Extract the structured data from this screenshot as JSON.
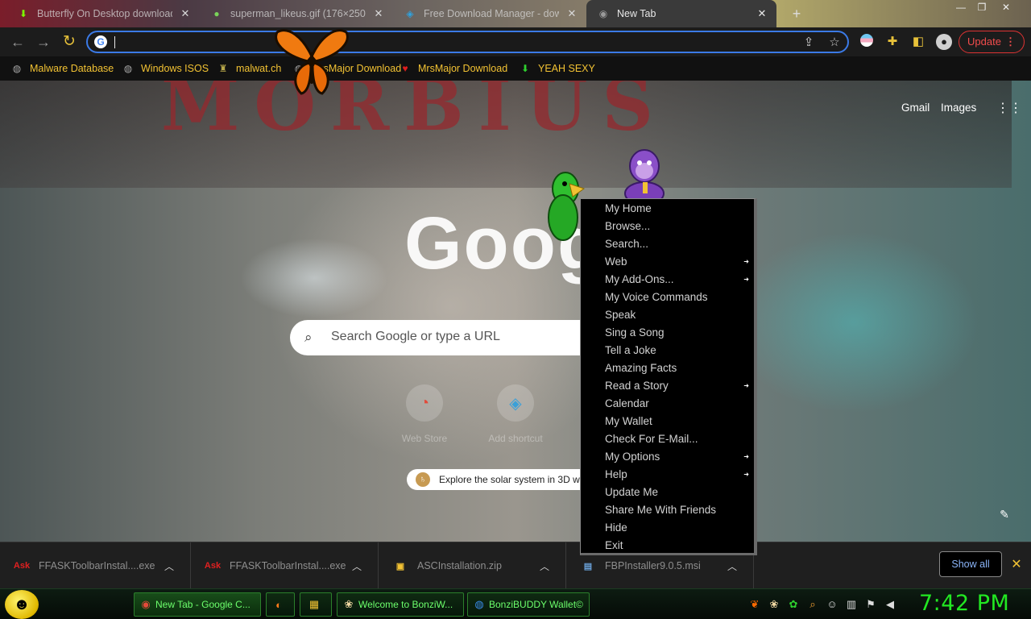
{
  "tabs": [
    {
      "title": "Butterfly On Desktop download -",
      "favicon": "download-arrow-icon",
      "close": "✕"
    },
    {
      "title": "superman_likeus.gif (176×250)",
      "favicon": "android-leaf-icon",
      "close": "✕"
    },
    {
      "title": "Free Download Manager - dow",
      "favicon": "fdm-icon",
      "close": "✕"
    },
    {
      "title": "New Tab",
      "favicon": "chrome-grey-icon",
      "close": "✕"
    }
  ],
  "toolbar": {
    "omnibox_value": "",
    "update_label": "Update",
    "update_dots": "⋮"
  },
  "bookmarks": [
    {
      "label": "Malware Database",
      "icon": "globe-icon"
    },
    {
      "label": "Windows ISOS",
      "icon": "globe-icon"
    },
    {
      "label": "malwat.ch",
      "icon": "android-icon"
    },
    {
      "label": "MrsMajor Download",
      "icon": "globe-icon"
    },
    {
      "label": "MrsMajor Download",
      "icon": "heart-icon"
    },
    {
      "label": "YEAH SEXY",
      "icon": "green-download-icon"
    }
  ],
  "ntp": {
    "background_text": "MORBIUS",
    "gmail": "Gmail",
    "images": "Images",
    "logo": "Google",
    "search_placeholder": "Search Google or type a URL",
    "shortcuts": [
      {
        "label": "Web Store"
      },
      {
        "label": "Add shortcut"
      }
    ],
    "promo": "Explore the solar system in 3D wi"
  },
  "context_menu": [
    {
      "label": "My Home",
      "submenu": false
    },
    {
      "label": "Browse...",
      "submenu": false
    },
    {
      "label": "Search...",
      "submenu": false
    },
    {
      "label": "Web",
      "submenu": true
    },
    {
      "label": "My Add-Ons...",
      "submenu": true
    },
    {
      "label": "My Voice Commands",
      "submenu": false
    },
    {
      "label": "Speak",
      "submenu": false
    },
    {
      "label": "Sing a Song",
      "submenu": false
    },
    {
      "label": "Tell a Joke",
      "submenu": false
    },
    {
      "label": "Amazing Facts",
      "submenu": false
    },
    {
      "label": "Read a Story",
      "submenu": true
    },
    {
      "label": "Calendar",
      "submenu": false
    },
    {
      "label": "My Wallet",
      "submenu": false
    },
    {
      "label": "Check For E-Mail...",
      "submenu": false
    },
    {
      "label": "My Options",
      "submenu": true
    },
    {
      "label": "Help",
      "submenu": true
    },
    {
      "label": "Update Me",
      "submenu": false
    },
    {
      "label": "Share Me With Friends",
      "submenu": false
    },
    {
      "label": "Hide",
      "submenu": false
    },
    {
      "label": "Exit",
      "submenu": false
    }
  ],
  "downloads": [
    {
      "name": "FFASKToolbarInstal....exe",
      "icon": "ask-icon"
    },
    {
      "name": "FFASKToolbarInstal....exe",
      "icon": "ask-icon"
    },
    {
      "name": "ASCInstallation.zip",
      "icon": "zip-icon"
    },
    {
      "name": "FBPInstaller9.0.5.msi",
      "icon": "msi-icon"
    }
  ],
  "shelf": {
    "show_all": "Show all",
    "close": "✕"
  },
  "taskbar": {
    "buttons": [
      {
        "label": "New Tab - Google C...",
        "icon": "chrome-icon"
      },
      {
        "label": "",
        "icon": "firefox-icon"
      },
      {
        "label": "",
        "icon": "folder-icon"
      },
      {
        "label": "Welcome to BonziW...",
        "icon": "bonzi-icon"
      },
      {
        "label": "BonziBUDDY Wallet©",
        "icon": "globe-blue-icon"
      }
    ],
    "clock": "7:42 PM"
  },
  "colors": {
    "bookmark_text": "#f2c233",
    "taskbar_text": "#6cff6c",
    "clock": "#22e822",
    "update_red": "#f24c4c",
    "omnibox_focus": "#3b7ae6",
    "show_all_text": "#8ab4f8"
  }
}
